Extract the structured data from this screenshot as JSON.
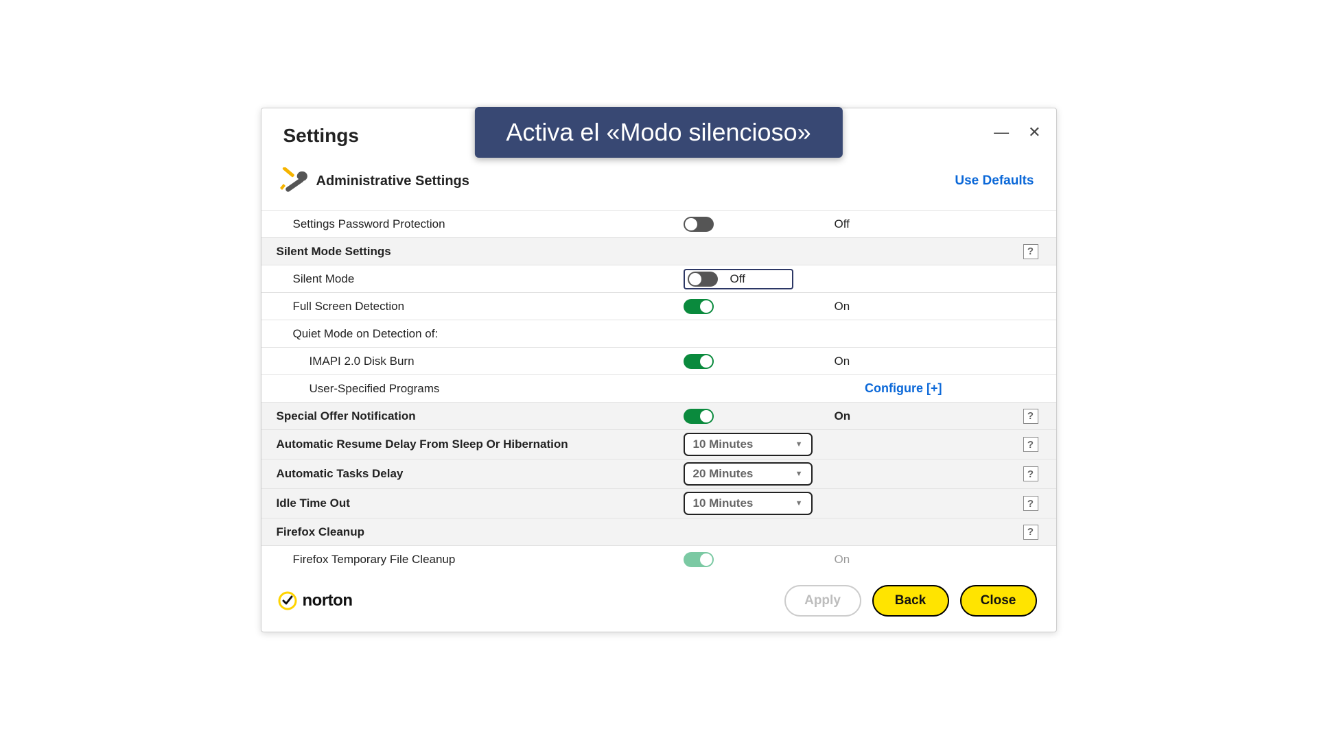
{
  "callout": "Activa el «Modo silencioso»",
  "title": "Settings",
  "section_title": "Administrative Settings",
  "use_defaults": "Use Defaults",
  "rows": {
    "pwd_protect": "Settings Password Protection",
    "silent_group": "Silent Mode Settings",
    "silent_mode": "Silent Mode",
    "full_screen": "Full Screen Detection",
    "quiet_mode_on": "Quiet Mode on Detection of:",
    "imapi": "IMAPI 2.0 Disk Burn",
    "user_programs": "User-Specified Programs",
    "special_offer": "Special Offer Notification",
    "auto_resume": "Automatic Resume Delay From Sleep Or Hibernation",
    "auto_tasks": "Automatic Tasks Delay",
    "idle_timeout": "Idle Time Out",
    "firefox_group": "Firefox Cleanup",
    "firefox_temp": "Firefox Temporary File Cleanup"
  },
  "states": {
    "on": "On",
    "off": "Off"
  },
  "select_values": {
    "auto_resume": "10 Minutes",
    "auto_tasks": "20 Minutes",
    "idle_timeout": "10 Minutes"
  },
  "configure": "Configure [+]",
  "help": "?",
  "brand": "norton",
  "buttons": {
    "apply": "Apply",
    "back": "Back",
    "close": "Close"
  }
}
